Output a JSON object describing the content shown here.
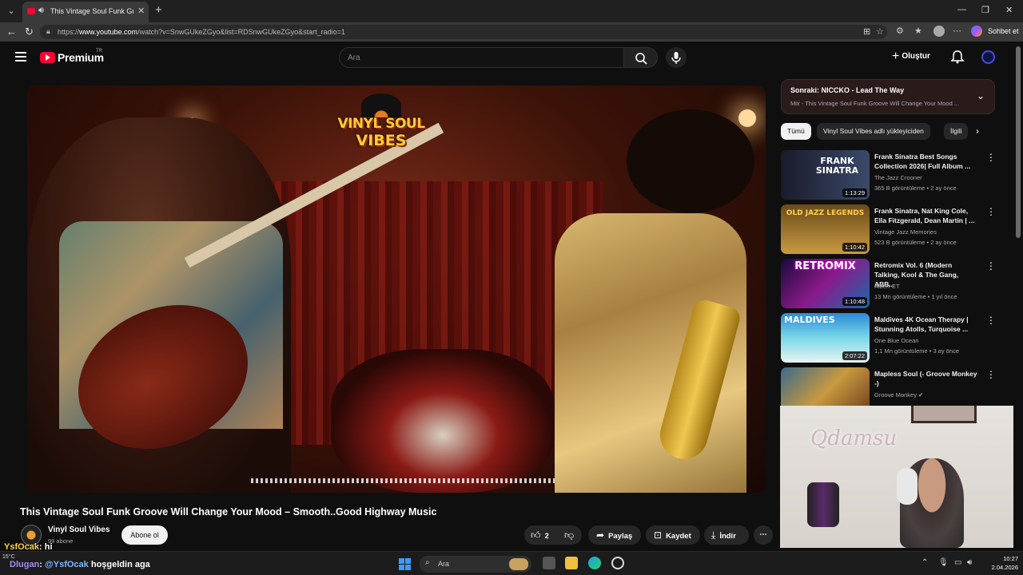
{
  "browser": {
    "tab_title": "This Vintage Soul Funk Groove Will Change Your Mood",
    "url_prefix": "https://",
    "url_host": "www.youtube.com",
    "url_path": "/watch?v=SnwGUkeZGyo&list=RDSnwGUkeZGyo&start_radio=1",
    "copilot_label": "Sohbet et"
  },
  "header": {
    "logo_text": "Premium",
    "logo_region": "TR",
    "search_placeholder": "Ara",
    "create_label": "Oluştur"
  },
  "video": {
    "overlay_logo_line1": "VINYL SOUL",
    "overlay_logo_line2": "VIBES",
    "title": "This Vintage Soul Funk Groove Will Change Your Mood – Smooth..Good Highway Music",
    "channel": "Vinyl Soul Vibes",
    "subscribers": "99 abone",
    "subscribe_label": "Abone ol",
    "likes": "2",
    "share_label": "Paylaş",
    "save_label": "Kaydet",
    "download_label": "İndir"
  },
  "up_next": {
    "title": "Sonraki: NICCKO - Lead The Way",
    "subtitle": "Mix - This Vintage Soul Funk Groove Will Change Your Mood ..."
  },
  "chips": [
    "Tümü",
    "Vinyl Soul Vibes adlı yükleyiciden",
    "İlgili"
  ],
  "recommendations": [
    {
      "title": "Frank Sinatra Best Songs Collection 2026| Full Album ...",
      "channel": "The Jazz Crooner",
      "meta": "365 B görüntüleme • 2 ay önce",
      "duration": "1:13:29",
      "thumb_text": "FRANK SINATRA"
    },
    {
      "title": "Frank Sinatra, Nat King Cole, Ella Fitzgerald, Dean Martin | ...",
      "channel": "Vintage Jazz Memories",
      "meta": "523 B görüntüleme • 2 ay önce",
      "duration": "1:10:42",
      "thumb_text": "OLD JAZZ LEGENDS"
    },
    {
      "title": "Retromix Vol. 6 (Modern Talking, Kool & The Gang, ABB...",
      "channel": "Albert CT",
      "meta": "13 Mn görüntüleme • 1 yıl önce",
      "duration": "1:10:48",
      "thumb_text": "RETROMIX"
    },
    {
      "title": "Maldives 4K Ocean Therapy | Stunning Atolls, Turquoise ...",
      "channel": "One Blue Ocean",
      "meta": "1,1 Mn görüntüleme • 3 ay önce",
      "duration": "2:07:22",
      "thumb_text": "MALDIVES"
    },
    {
      "title": "Mapless Soul (- Groove Monkey -)",
      "channel": "Groove Monkey",
      "meta": "",
      "duration": "",
      "thumb_text": ""
    }
  ],
  "webcam": {
    "neon_text": "Qdamsu"
  },
  "chat": [
    {
      "user": "YsfOcak",
      "message": "hi"
    },
    {
      "user": "Dlugan",
      "mention": "@YsfOcak",
      "message": "hoşgeldin aga"
    }
  ],
  "taskbar": {
    "weather": "15°C",
    "search_label": "Ara",
    "time": "10:27",
    "date": "2.04.2026"
  }
}
